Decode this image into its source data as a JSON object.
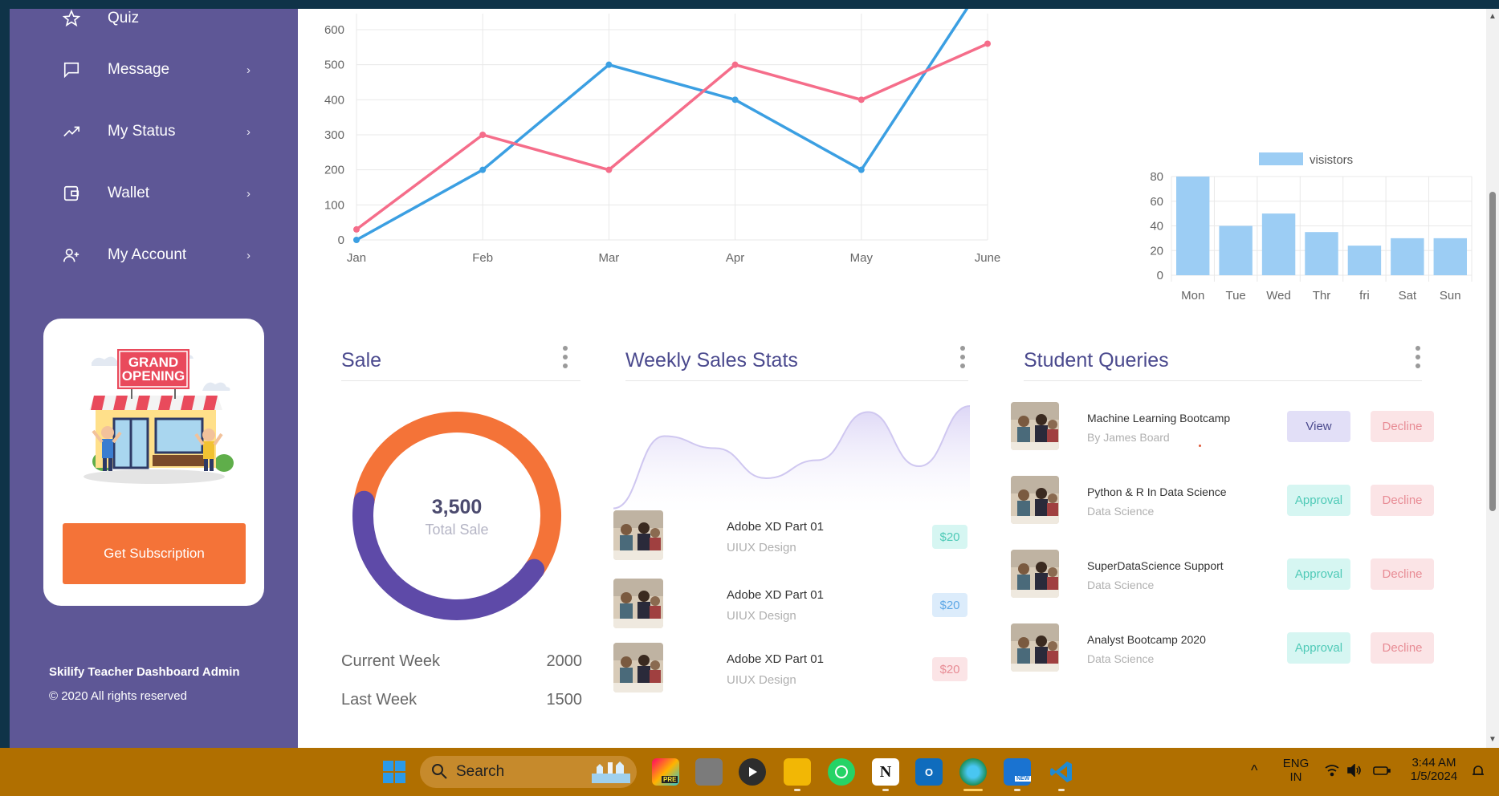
{
  "sidebar": {
    "items": [
      {
        "label": "Quiz",
        "icon": "star-icon"
      },
      {
        "label": "Message",
        "icon": "message-icon"
      },
      {
        "label": "My Status",
        "icon": "trending-icon"
      },
      {
        "label": "Wallet",
        "icon": "wallet-icon"
      },
      {
        "label": "My Account",
        "icon": "add-user-icon"
      }
    ],
    "promo": {
      "sign_line1": "GRAND",
      "sign_line2": "OPENING",
      "button_label": "Get Subscription"
    },
    "footer_brand": "Skilify Teacher Dashboard Admin",
    "footer_copy": "© 2020 All rights reserved"
  },
  "line_chart": {
    "chart_data": {
      "type": "line",
      "x": [
        "Jan",
        "Feb",
        "Mar",
        "Apr",
        "May",
        "June"
      ],
      "series": [
        {
          "values": [
            0,
            200,
            500,
            400,
            200,
            750
          ],
          "color": "#3b9fe2"
        },
        {
          "values": [
            30,
            300,
            200,
            500,
            400,
            560
          ],
          "color": "#f56d8a"
        }
      ],
      "ylim": [
        0,
        600
      ],
      "yticks": [
        "600",
        "500",
        "400",
        "300",
        "200",
        "100",
        "0"
      ],
      "grid": true
    }
  },
  "bar_chart": {
    "chart_data": {
      "type": "bar",
      "categories": [
        "Mon",
        "Tue",
        "Wed",
        "Thr",
        "fri",
        "Sat",
        "Sun"
      ],
      "series": [
        {
          "name": "visistors",
          "values": [
            80,
            40,
            50,
            35,
            24,
            30,
            30
          ],
          "color": "#9ccdf4"
        }
      ],
      "ylim": [
        0,
        80
      ],
      "yticks": [
        "80",
        "60",
        "40",
        "20",
        "0"
      ],
      "legend": "top"
    }
  },
  "sale": {
    "title": "Sale",
    "total": "3,500",
    "total_label": "Total Sale",
    "rows": [
      {
        "label": "Current Week",
        "value": "2000"
      },
      {
        "label": "Last Week",
        "value": "1500"
      }
    ],
    "chart_data": {
      "type": "pie",
      "segments": [
        {
          "value": 2000,
          "color": "#f47338"
        },
        {
          "value": 1500,
          "color": "#5e4aa8"
        }
      ]
    }
  },
  "weekly": {
    "title": "Weekly Sales Stats",
    "chart_data": {
      "type": "area",
      "values": [
        0.05,
        0.65,
        0.55,
        0.3,
        0.45,
        0.85,
        0.4,
        0.9
      ],
      "color": "#d9d2f5"
    },
    "items": [
      {
        "title": "Adobe XD Part 01",
        "sub": "UIUX Design",
        "price": "$20",
        "price_bg": "#d6f6f2",
        "price_color": "#4fcab7"
      },
      {
        "title": "Adobe XD Part 01",
        "sub": "UIUX Design",
        "price": "$20",
        "price_bg": "#dcecfb",
        "price_color": "#5ea8e6"
      },
      {
        "title": "Adobe XD Part 01",
        "sub": "UIUX Design",
        "price": "$20",
        "price_bg": "#fbe4e6",
        "price_color": "#e88c95"
      }
    ]
  },
  "queries": {
    "title": "Student Queries",
    "items": [
      {
        "title": "Machine Learning Bootcamp",
        "sub": "By James Board",
        "action": "View",
        "decline": "Decline"
      },
      {
        "title": "Python & R In Data Science",
        "sub": "Data Science",
        "action": "Approval",
        "decline": "Decline"
      },
      {
        "title": "SuperDataScience Support",
        "sub": "Data Science",
        "action": "Approval",
        "decline": "Decline"
      },
      {
        "title": "Analyst Bootcamp 2020",
        "sub": "Data Science",
        "action": "Approval",
        "decline": "Decline"
      }
    ]
  },
  "taskbar": {
    "search_label": "Search",
    "lang1": "ENG",
    "lang2": "IN",
    "time": "3:44 AM",
    "date": "1/5/2024",
    "pre_badge": "PRE",
    "new_badge": "NEW"
  }
}
